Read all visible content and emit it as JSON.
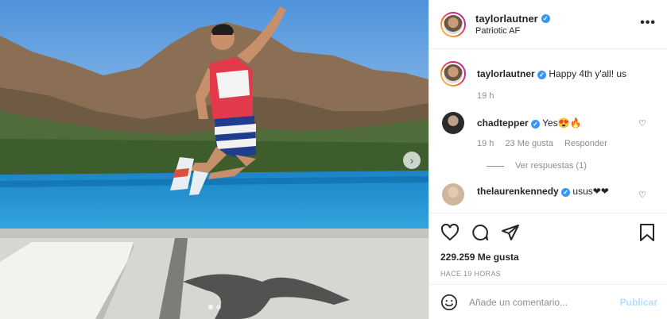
{
  "post": {
    "author": "taylorlautner",
    "location": "Patriotic AF",
    "more_label": "•••",
    "caption": {
      "username": "taylorlautner",
      "text": "Happy 4th y'all! us",
      "time": "19 h"
    }
  },
  "comments": [
    {
      "username": "chadtepper",
      "text": "Yes😍🔥",
      "time": "19 h",
      "likes": "23 Me gusta",
      "reply": "Responder",
      "view_replies": "Ver respuestas (1)"
    },
    {
      "username": "thelaurenkennedy",
      "text": "usus❤❤"
    }
  ],
  "actions": {
    "likes_count": "229.259 Me gusta",
    "posted_ago": "HACE 19 HORAS"
  },
  "add_comment": {
    "placeholder": "Añade un comentario...",
    "publish": "Publicar"
  },
  "carousel": {
    "next_glyph": "›",
    "slides": 2,
    "active": 1
  },
  "colors": {
    "verified": "#3897f0",
    "publish_disabled": "#b2dffc",
    "meta_gray": "#8e8e8e"
  }
}
